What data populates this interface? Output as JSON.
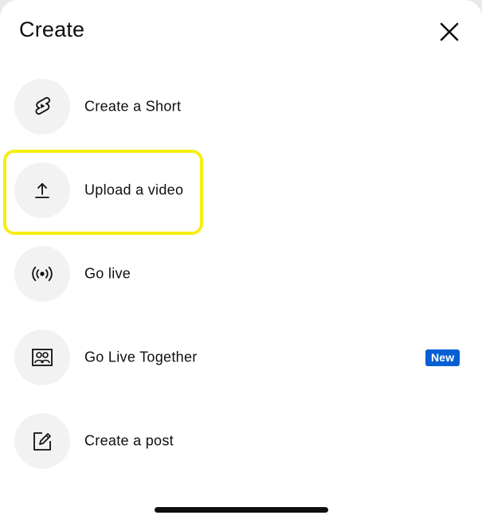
{
  "header": {
    "title": "Create",
    "close_icon": "close-icon"
  },
  "items": [
    {
      "label": "Create a Short",
      "icon": "shorts-icon"
    },
    {
      "label": "Upload a video",
      "icon": "upload-icon"
    },
    {
      "label": "Go live",
      "icon": "live-broadcast-icon"
    },
    {
      "label": "Go Live Together",
      "icon": "go-live-together-icon",
      "badge": "New"
    },
    {
      "label": "Create a post",
      "icon": "edit-post-icon"
    }
  ],
  "colors": {
    "highlight": "#f5ee12",
    "badge": "#065fd4",
    "icon_circle": "#f2f2f2",
    "text": "#0f0f0f"
  }
}
